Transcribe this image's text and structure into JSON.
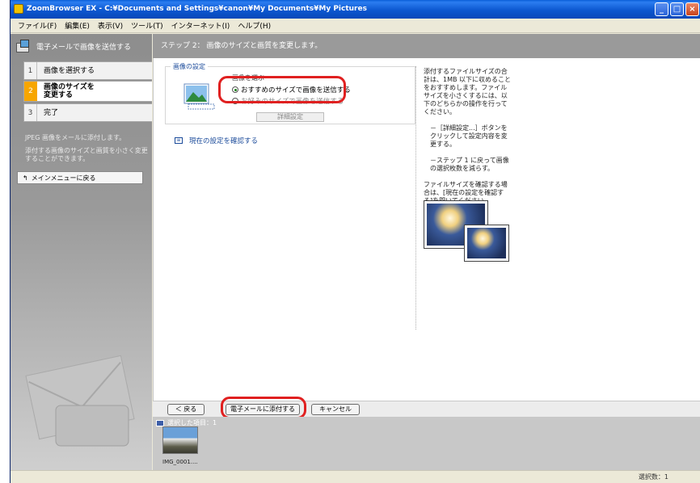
{
  "window": {
    "title": "ZoomBrowser EX  -  C:¥Documents and Settings¥canon¥My Documents¥My Pictures"
  },
  "menubar": {
    "items": [
      "ファイル(F)",
      "編集(E)",
      "表示(V)",
      "ツール(T)",
      "インターネット(I)",
      "ヘルプ(H)"
    ]
  },
  "sidebar": {
    "header": "電子メールで画像を送信する",
    "steps": [
      {
        "num": "1",
        "label": "画像を選択する"
      },
      {
        "num": "2",
        "label": "画像のサイズを\n変更する"
      },
      {
        "num": "3",
        "label": "完了"
      }
    ],
    "info1": "JPEG 画像をメールに添付します。",
    "info2": "添付する画像のサイズと画質を小さく変更することができます。",
    "back_button": "メインメニューに戻る"
  },
  "main": {
    "header": "ステップ 2： 画像のサイズと画質を変更します。",
    "group_title": "画像の設定",
    "choose_label": "画像を選ぶ",
    "option_recommended": "おすすめのサイズで画像を送信する",
    "option_custom": "お好みのサイズで画像を送信する",
    "detail_button": "詳細設定",
    "confirm_link": "現在の設定を確認する"
  },
  "help": {
    "para1": "添付するファイルサイズの合計は、1MB 以下に収めることをおすすめします。ファイルサイズを小さくするには、以下のどちらかの操作を行ってください。",
    "bullet1": "－［詳細設定...］ボタンをクリックして設定内容を変更する。",
    "bullet2": "－ステップ 1 に戻って画像の選択枚数を減らす。",
    "para2": "ファイルサイズを確認する場合は、[現在の設定を確認する]を開いてください。"
  },
  "bottom": {
    "back_button": "＜ 戻る",
    "attach_button": "電子メールに添付する",
    "cancel_button": "キャンセル"
  },
  "selected": {
    "title": "選択した項目：1",
    "thumb_label": "IMG_0001...."
  },
  "status": {
    "text": "選択数：1"
  },
  "colors": {
    "titlebar": "#0c57d0",
    "highlight": "#e02020",
    "sidebar": "#9a9a9a",
    "active_step": "#f7a600",
    "link": "#1a4a9a"
  }
}
